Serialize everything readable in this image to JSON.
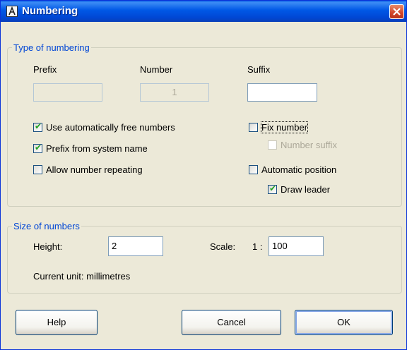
{
  "window": {
    "title": "Numbering",
    "icon": "autocad-a-icon"
  },
  "type_group": {
    "title": "Type of numbering",
    "prefix": {
      "label": "Prefix",
      "value": ""
    },
    "number": {
      "label": "Number",
      "value": "1"
    },
    "suffix": {
      "label": "Suffix",
      "value": ""
    },
    "use_free_numbers": {
      "label": "Use automatically free numbers",
      "checked": true
    },
    "prefix_from_system": {
      "label": "Prefix from system name",
      "checked": true
    },
    "allow_repeat": {
      "label": "Allow number repeating",
      "checked": false
    },
    "fix_number": {
      "label": "Fix number",
      "checked": false
    },
    "number_suffix": {
      "label": "Number suffix",
      "checked": false,
      "enabled": false
    },
    "automatic_position": {
      "label": "Automatic position",
      "checked": false
    },
    "draw_leader": {
      "label": "Draw leader",
      "checked": true
    }
  },
  "size_group": {
    "title": "Size of numbers",
    "height": {
      "label": "Height:",
      "value": "2"
    },
    "scale": {
      "label": "Scale:",
      "prefix": "1 :",
      "value": "100"
    },
    "current_unit": "Current unit: millimetres"
  },
  "buttons": {
    "help": "Help",
    "cancel": "Cancel",
    "ok": "OK"
  },
  "colors": {
    "titlebar": "#0058e6",
    "group_title": "#0046d5",
    "dialog_bg": "#ece9d8",
    "check": "#21a121"
  }
}
